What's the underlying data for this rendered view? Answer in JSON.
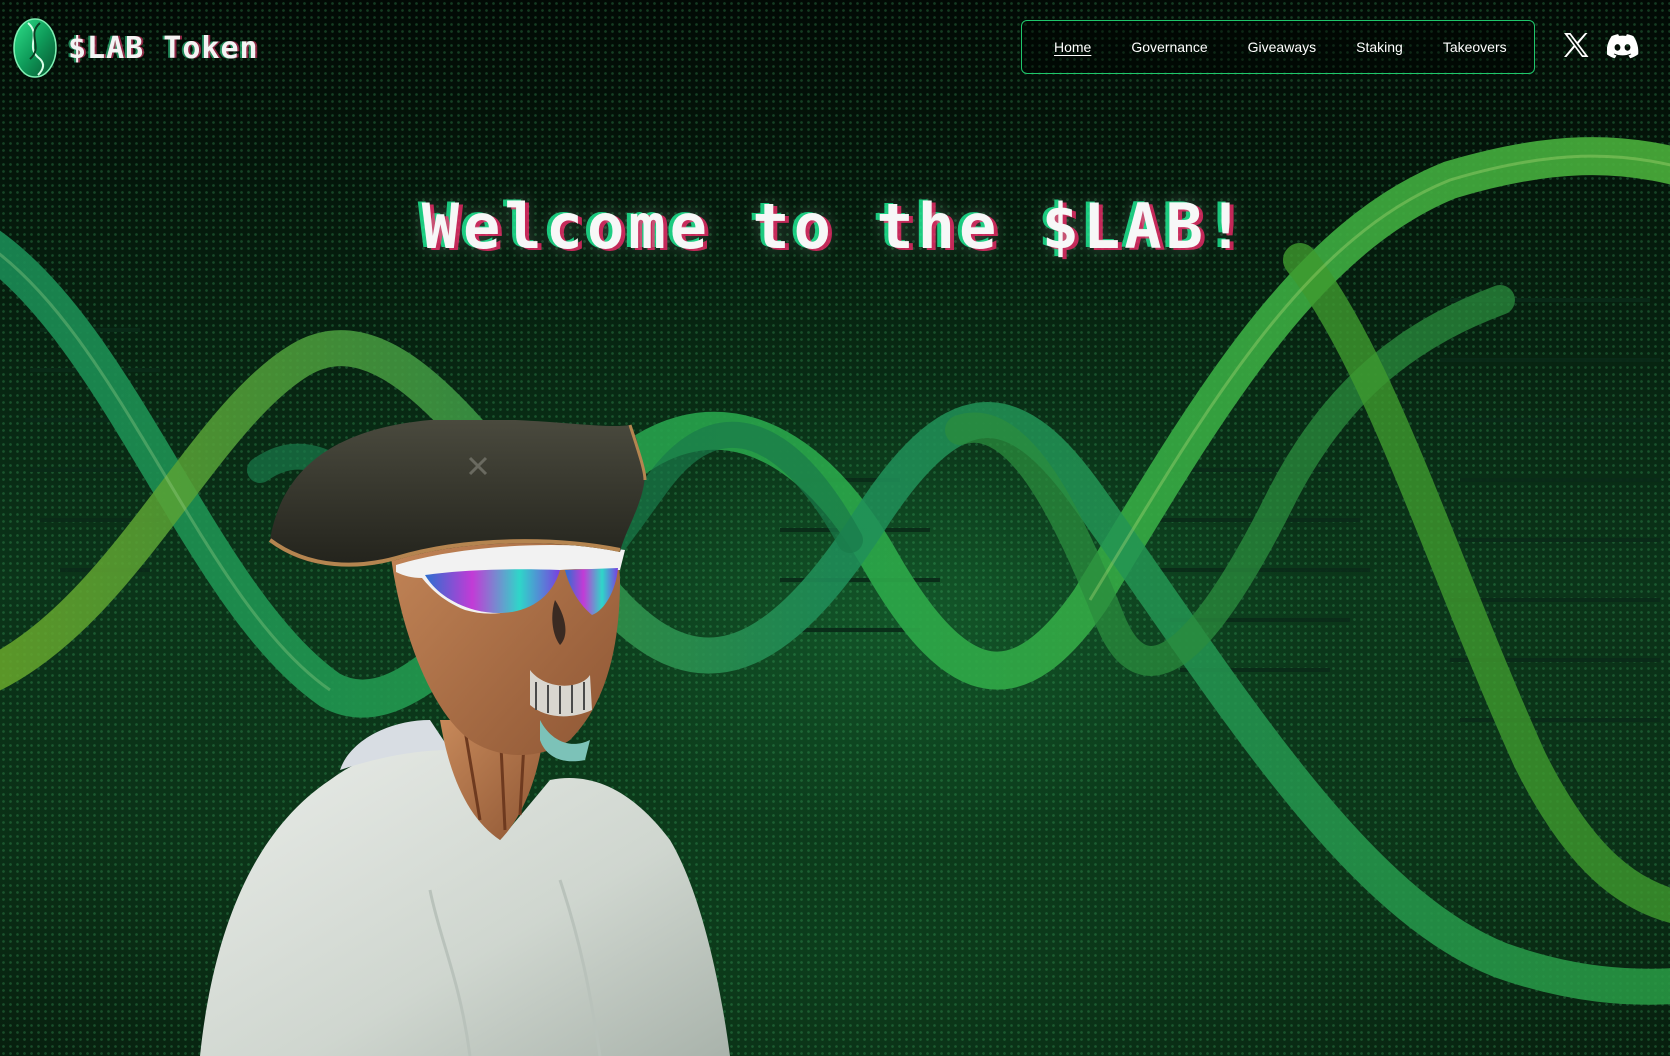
{
  "brand": {
    "name": "$LAB Token"
  },
  "nav": {
    "items": [
      {
        "label": "Home",
        "active": true
      },
      {
        "label": "Governance",
        "active": false
      },
      {
        "label": "Giveaways",
        "active": false
      },
      {
        "label": "Staking",
        "active": false
      },
      {
        "label": "Takeovers",
        "active": false
      }
    ],
    "border_color": "#1fc66b"
  },
  "social": [
    {
      "icon": "x-twitter-icon"
    },
    {
      "icon": "discord-icon"
    }
  ],
  "hero": {
    "title": "Welcome to the $LAB!",
    "background": "dna-helix-green",
    "character": "pirate-skeleton-in-labcoat"
  },
  "colors": {
    "accent": "#1fc66b",
    "background": "#041208"
  }
}
